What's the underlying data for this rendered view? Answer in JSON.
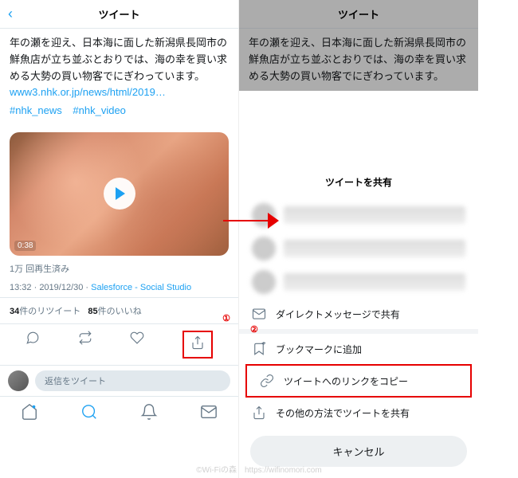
{
  "left": {
    "header_title": "ツイート",
    "tweet_text": "年の瀬を迎え、日本海に面した新潟県長岡市の鮮魚店が立ち並ぶとおりでは、海の幸を買い求める大勢の買い物客でにぎわっています。",
    "link_text": "www3.nhk.or.jp/news/html/2019…",
    "hashtags": [
      "#nhk_news",
      "#nhk_video"
    ],
    "duration": "0:38",
    "views": "1万 回再生済み",
    "time": "13:32",
    "date": "2019/12/30",
    "source": "Salesforce - Social Studio",
    "retweet_count": "34",
    "retweet_label": "件のリツイート",
    "like_count": "85",
    "like_label": "件のいいね",
    "marker1": "①",
    "reply_placeholder": "返信をツイート"
  },
  "right": {
    "header_title": "ツイート",
    "tweet_text": "年の瀬を迎え、日本海に面した新潟県長岡市の鮮魚店が立ち並ぶとおりでは、海の幸を買い求める大勢の買い物客でにぎわっています。",
    "sheet_title": "ツイートを共有",
    "dm_label": "ダイレクトメッセージで共有",
    "bookmark_label": "ブックマークに追加",
    "copy_label": "ツイートへのリンクをコピー",
    "other_label": "その他の方法でツイートを共有",
    "cancel_label": "キャンセル",
    "marker2": "②"
  },
  "watermark": "©Wi-Fiの森　https://wifinomori.com"
}
